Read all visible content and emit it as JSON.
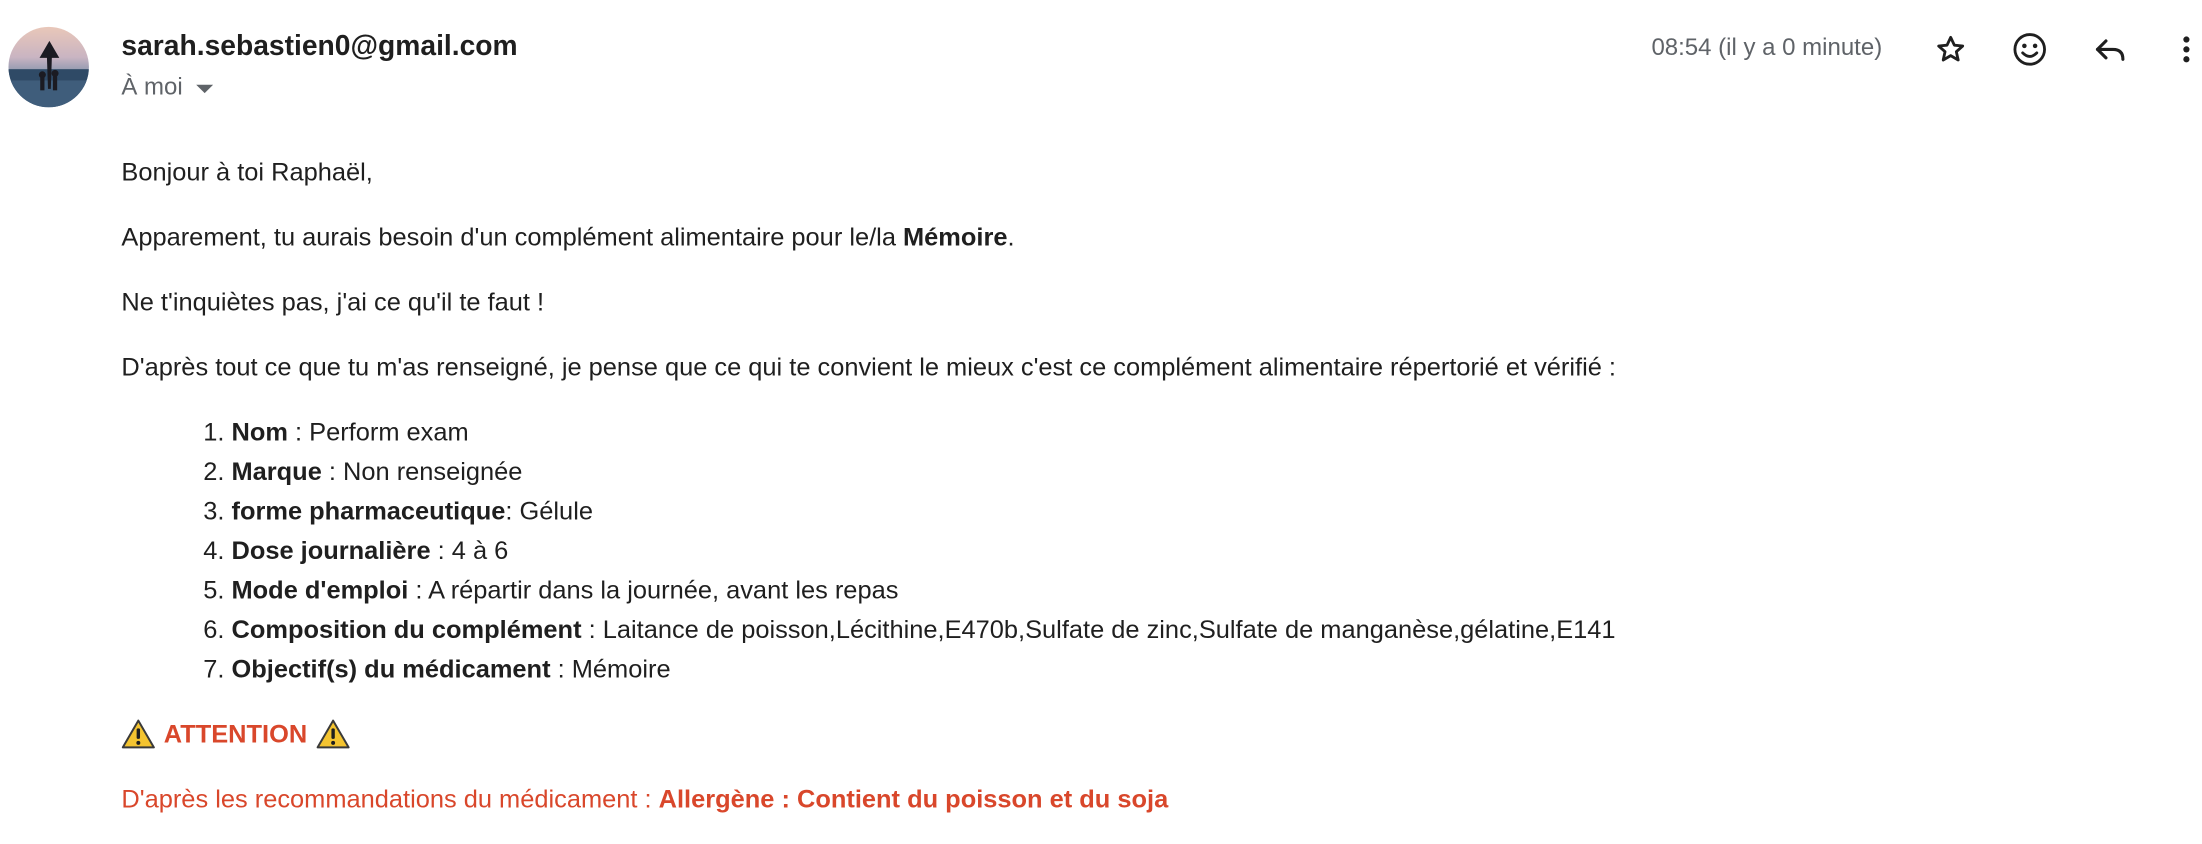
{
  "header": {
    "sender": "sarah.sebastien0@gmail.com",
    "recipient": "À moi",
    "time": "08:54 (il y a 0 minute)"
  },
  "body": {
    "greeting": "Bonjour à toi Raphaël,",
    "line1_prefix": "Apparement, tu aurais besoin d'un complément alimentaire pour le/la ",
    "line1_bold": "Mémoire",
    "line1_suffix": ".",
    "line2": "Ne t'inquiètes pas, j'ai ce qu'il te faut !",
    "line3": "D'après tout ce que tu m'as renseigné, je pense que ce qui te convient le mieux c'est ce complément alimentaire répertorié et vérifié :",
    "items": [
      {
        "label": "Nom",
        "sep": " : ",
        "value": "Perform exam"
      },
      {
        "label": "Marque",
        "sep": " : ",
        "value": "Non renseignée"
      },
      {
        "label": "forme pharmaceutique",
        "sep": ": ",
        "value": "Gélule"
      },
      {
        "label": "Dose journalière",
        "sep": " : ",
        "value": "4 à 6"
      },
      {
        "label": "Mode d'emploi",
        "sep": " : ",
        "value": "A répartir dans la journée, avant les repas"
      },
      {
        "label": "Composition du complément",
        "sep": " : ",
        "value": "Laitance de poisson,Lécithine,E470b,Sulfate de zinc,Sulfate de manganèse,gélatine,E141"
      },
      {
        "label": "Objectif(s) du médicament",
        "sep": " : ",
        "value": "Mémoire"
      }
    ],
    "attention": "ATTENTION",
    "recommend_prefix": "D'après les recommandations du médicament : ",
    "recommend_bold": "Allergène : Contient du poisson et du soja"
  },
  "colors": {
    "warning": "#d9472b",
    "text": "#1f1f1f",
    "muted": "#5f6368"
  },
  "icons": [
    "star-icon",
    "emoji-icon",
    "reply-icon",
    "more-vert-icon",
    "warning-icon"
  ]
}
